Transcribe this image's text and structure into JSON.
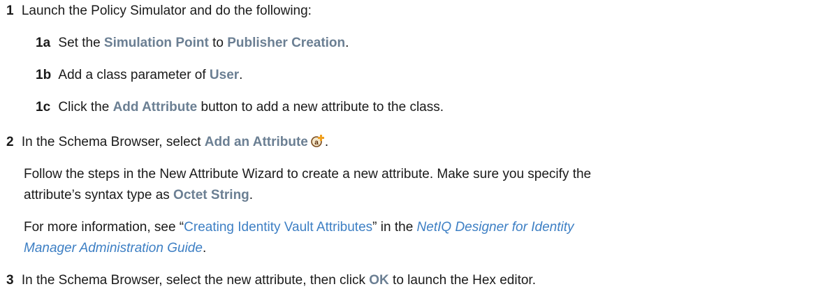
{
  "step1": {
    "num": "1",
    "text": "Launch the Policy Simulator and do the following:",
    "substeps": {
      "a": {
        "num": "1a",
        "pre": "Set the ",
        "ui1": "Simulation Point",
        "mid": " to ",
        "ui2": "Publisher Creation",
        "post": "."
      },
      "b": {
        "num": "1b",
        "pre": "Add a class parameter of ",
        "ui1": "User",
        "post": "."
      },
      "c": {
        "num": "1c",
        "pre": "Click the ",
        "ui1": "Add Attribute",
        "post": " button to add a new attribute to the class."
      }
    }
  },
  "step2": {
    "num": "2",
    "pre": "In the Schema Browser, select ",
    "ui1": "Add an Attribute",
    "post": ".",
    "icon": "add-attribute-icon",
    "para1_line1": "Follow the steps in the New Attribute Wizard to create a new attribute. Make sure you specify the",
    "para1_line2_pre": "attribute’s syntax type as ",
    "para1_line2_ui": "Octet String",
    "para1_line2_post": ".",
    "para2_pre": "For more information, see “",
    "para2_link": "Creating Identity Vault Attributes",
    "para2_mid": "” in the ",
    "para2_guide_line1": "NetIQ Designer for Identity",
    "para2_guide_line2": "Manager Administration Guide",
    "para2_post": "."
  },
  "step3": {
    "num": "3",
    "pre": "In the Schema Browser, select the new attribute, then click ",
    "ui1": "OK",
    "post": " to launch the Hex editor."
  },
  "colors": {
    "ui_text": "#6b7f93",
    "link": "#3d7fc4",
    "body_text": "#1a1a1a"
  }
}
